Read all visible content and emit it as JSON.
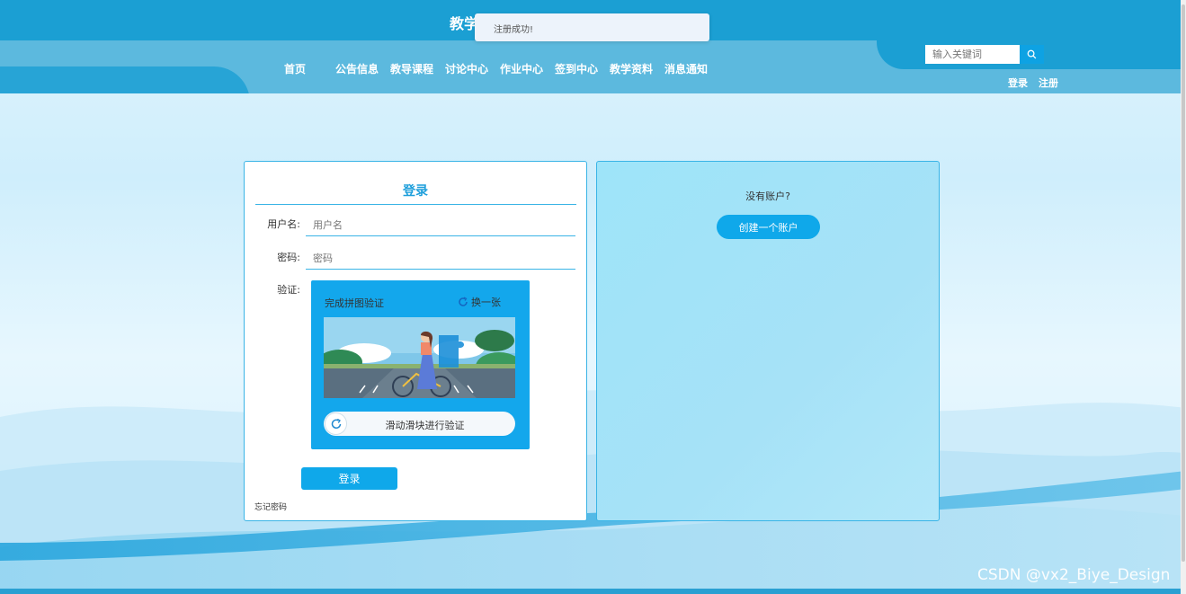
{
  "header": {
    "site_title": "教学",
    "toast": "注册成功!",
    "nav": [
      {
        "label": "首页",
        "name": "nav-home"
      },
      {
        "label": "公告信息",
        "name": "nav-announcements"
      },
      {
        "label": "教导课程",
        "name": "nav-courses"
      },
      {
        "label": "讨论中心",
        "name": "nav-discussion"
      },
      {
        "label": "作业中心",
        "name": "nav-homework"
      },
      {
        "label": "签到中心",
        "name": "nav-checkin"
      },
      {
        "label": "教学资料",
        "name": "nav-materials"
      },
      {
        "label": "消息通知",
        "name": "nav-notifications"
      }
    ],
    "search_placeholder": "输入关键词",
    "login_link": "登录",
    "register_link": "注册"
  },
  "login": {
    "title": "登录",
    "username_label": "用户名:",
    "username_placeholder": "用户名",
    "password_label": "密码:",
    "password_placeholder": "密码",
    "verify_label": "验证:",
    "captcha_hint": "完成拼图验证",
    "captcha_refresh": "换一张",
    "slider_text": "滑动滑块进行验证",
    "submit": "登录",
    "forgot": "忘记密码"
  },
  "register": {
    "prompt": "没有账户?",
    "create_button": "创建一个账户"
  },
  "watermark": "CSDN @vx2_Biye_Design",
  "colors": {
    "header": "#1b9fd3",
    "accent": "#0fa8ea",
    "border": "#3ab4e6"
  }
}
